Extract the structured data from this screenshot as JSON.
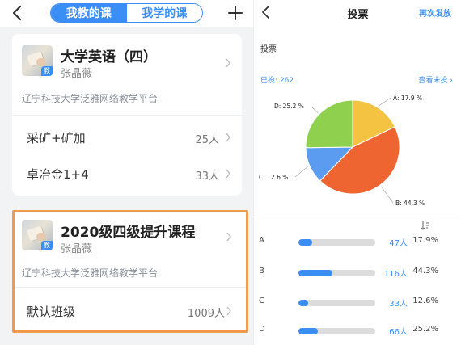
{
  "left": {
    "tabs": [
      {
        "label": "我教的课",
        "active": true
      },
      {
        "label": "我学的课",
        "active": false
      }
    ],
    "add_icon": "plus-icon",
    "back_icon": "back-chevron-icon",
    "courses": [
      {
        "title": "大学英语（四）",
        "teacher": "张晶薇",
        "cover_tag": "教",
        "platform": "辽宁科技大学泛雅网络教学平台",
        "classes": [
          {
            "name": "采矿+矿加",
            "count": "25人"
          },
          {
            "name": "卓冶金1+4",
            "count": "33人"
          }
        ]
      },
      {
        "title": "2020级四级提升课程",
        "teacher": "张晶薇",
        "cover_tag": "教",
        "platform": "辽宁科技大学泛雅网络教学平台",
        "classes": [
          {
            "name": "默认班级",
            "count": "1009人"
          }
        ]
      }
    ],
    "highlight_color": "#ef9a4c",
    "accent": "#3a8ef6"
  },
  "right": {
    "title": "投票",
    "resend_label": "再次发放",
    "section_label": "投票",
    "voted_label": "已投: 262",
    "view_unvoted_label": "查看未投 ›",
    "sort_icon": "sort-icon",
    "chart_data": {
      "type": "pie",
      "labels": [
        "A",
        "B",
        "C",
        "D"
      ],
      "slice_labels": [
        "A: 17.9 %",
        "B: 44.3 %",
        "C: 12.6 %",
        "D: 25.2 %"
      ],
      "values": [
        17.9,
        44.3,
        12.6,
        25.2
      ],
      "colors": [
        "#f5c342",
        "#ee6532",
        "#5b9cf0",
        "#8fd14f"
      ]
    },
    "results": [
      {
        "option": "A",
        "count": "47人",
        "percent": "17.9%",
        "fraction": 0.179
      },
      {
        "option": "B",
        "count": "116人",
        "percent": "44.3%",
        "fraction": 0.443
      },
      {
        "option": "C",
        "count": "33人",
        "percent": "12.6%",
        "fraction": 0.126
      },
      {
        "option": "D",
        "count": "66人",
        "percent": "25.2%",
        "fraction": 0.252
      }
    ]
  }
}
